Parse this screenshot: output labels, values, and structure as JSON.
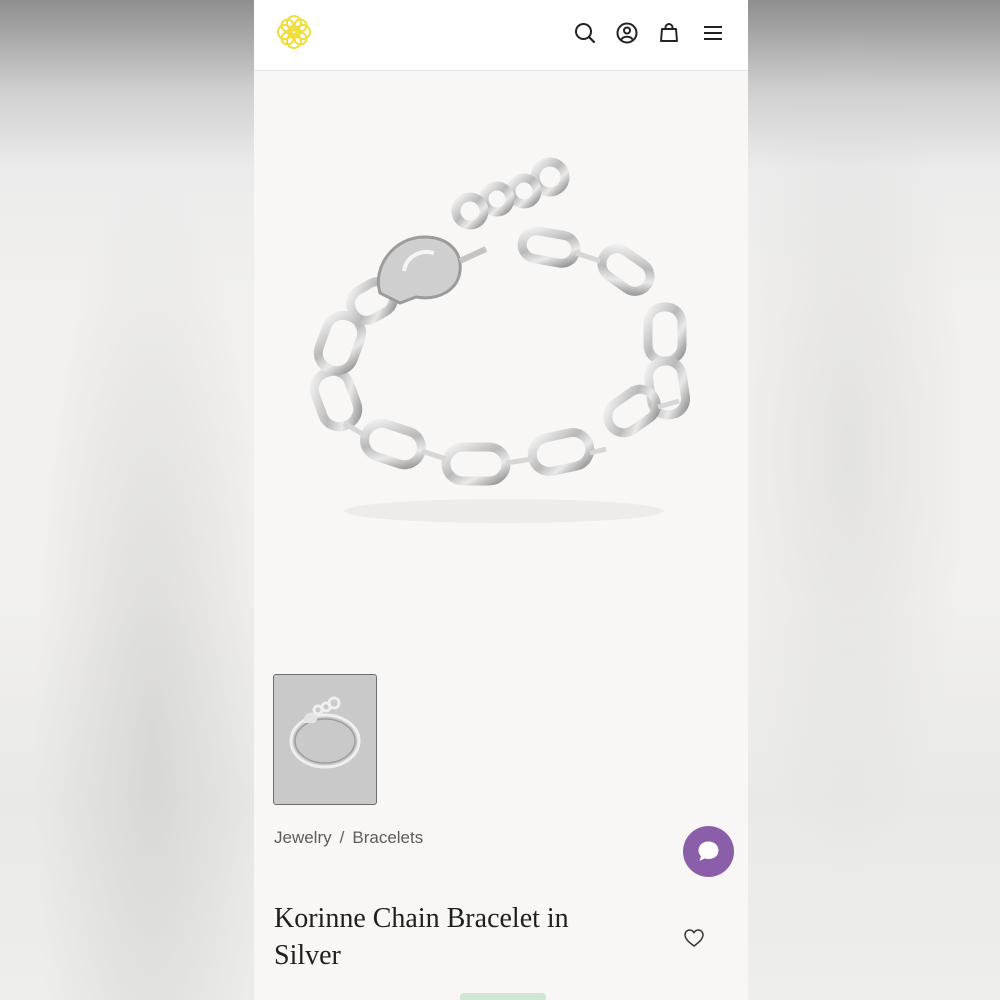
{
  "brand": {
    "logo_icon": "kendra-scott-flower-logo-icon",
    "logo_color": "#f2e14b"
  },
  "header": {
    "icons": [
      "search-icon",
      "account-icon",
      "bag-icon",
      "menu-icon"
    ]
  },
  "gallery": {
    "main_image": "silver-chain-bracelet-photo",
    "thumbnails": [
      {
        "image": "silver-chain-bracelet-thumbnail",
        "selected": true
      }
    ]
  },
  "breadcrumb": {
    "items": [
      "Jewelry",
      "Bracelets"
    ],
    "separator": "/"
  },
  "product": {
    "title_line1": "Korinne Chain Bracelet in",
    "title_line2": "Silver"
  },
  "chat": {
    "icon": "chat-bubble-icon",
    "color": "#8a5ea8"
  },
  "wishlist": {
    "icon": "heart-icon"
  },
  "colors": {
    "text": "#1f1f1f",
    "muted": "#5c5c5c",
    "page_bg": "#f8f7f5"
  }
}
